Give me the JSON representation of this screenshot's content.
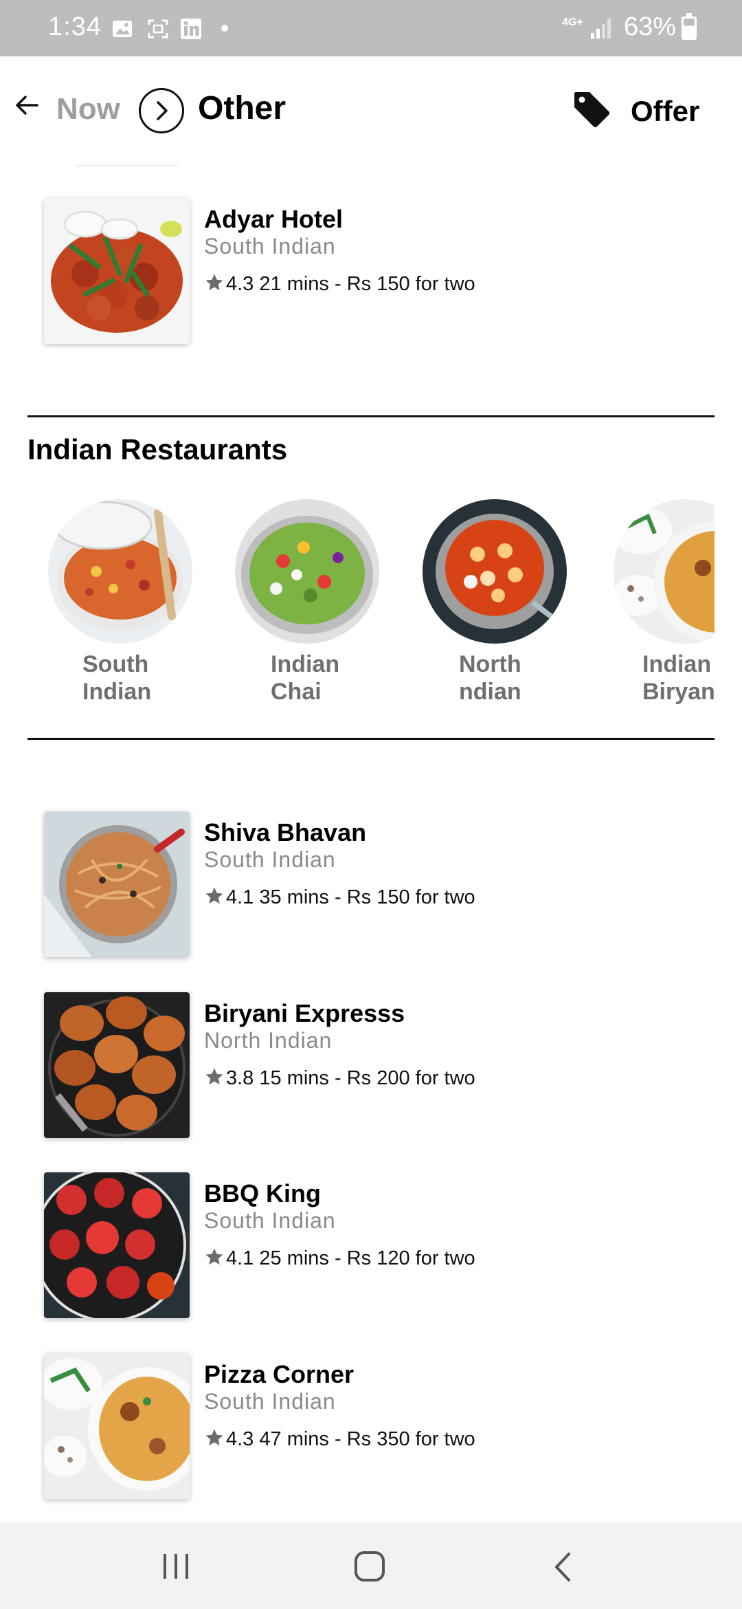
{
  "status_bar": {
    "time": "1:34",
    "network": "4G+",
    "battery": "63%",
    "icons": [
      "gallery-icon",
      "screenshot-icon",
      "linkedin-icon",
      "notification-dot"
    ]
  },
  "header": {
    "crumb_now": "Now",
    "crumb_other": "Other",
    "offer_label": "Offer"
  },
  "top_restaurant": {
    "name": "Adyar Hotel",
    "cuisine": "South Indian",
    "rating": "4.3",
    "meta": "21 mins - Rs 150 for two"
  },
  "section": {
    "title": "Indian Restaurants",
    "categories": [
      {
        "label": "South\nIndian",
        "image": "paella-dish"
      },
      {
        "label": "Indian\nChai",
        "image": "salad-bowl"
      },
      {
        "label": "North\nndian",
        "image": "gnocchi-skillet"
      },
      {
        "label": "Indian\nBiryan",
        "image": "biryani-bowl"
      }
    ]
  },
  "restaurants": [
    {
      "name": "Shiva Bhavan",
      "cuisine": "South Indian",
      "rating": "4.1",
      "meta": "35 mins - Rs 150 for two"
    },
    {
      "name": "Biryani Expresss",
      "cuisine": "North Indian",
      "rating": "3.8",
      "meta": "15 mins - Rs 200 for two"
    },
    {
      "name": "BBQ King",
      "cuisine": "South Indian",
      "rating": "4.1",
      "meta": "25 mins - Rs 120 for two"
    },
    {
      "name": "Pizza Corner",
      "cuisine": "South Indian",
      "rating": "4.3",
      "meta": "47 mins - Rs 350 for two"
    }
  ],
  "nav": {
    "buttons": [
      "recents-icon",
      "home-icon",
      "back-nav-icon"
    ]
  },
  "colors": {
    "status_bar": "#bdbdbd",
    "muted_text": "#8a8a8a",
    "star": "#6b6b6b",
    "nav_bar": "#f2f2f2"
  }
}
